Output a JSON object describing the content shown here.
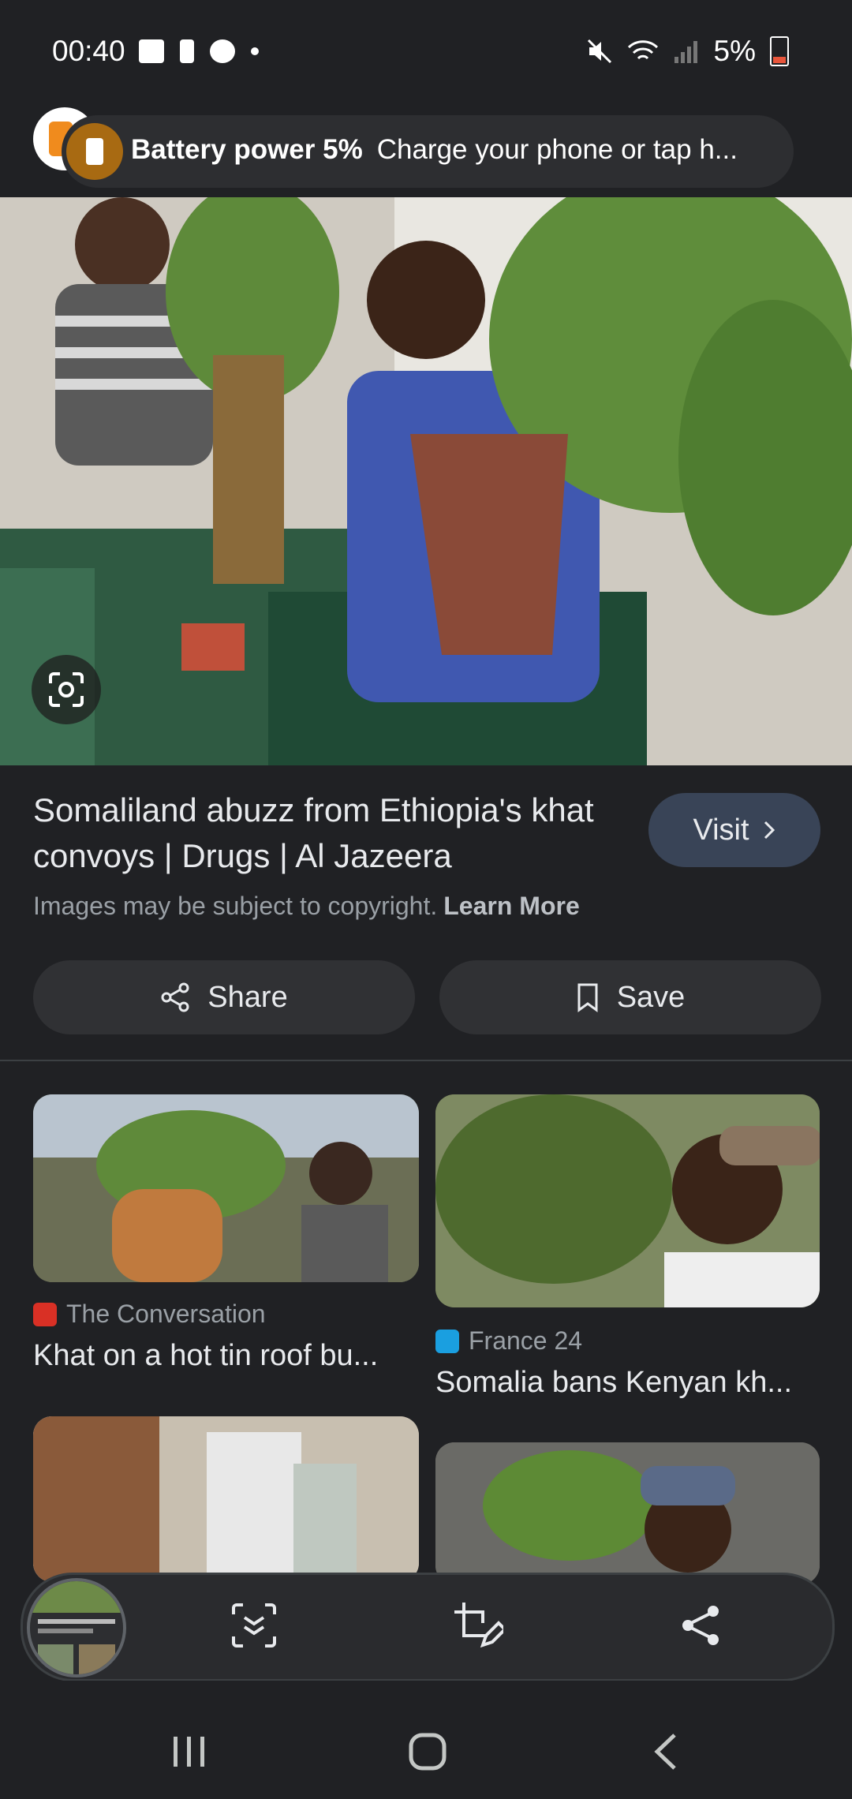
{
  "status_bar": {
    "time": "00:40",
    "battery_percent": "5%"
  },
  "notification": {
    "title": "Battery power 5%",
    "body": "Charge your phone or tap h..."
  },
  "result": {
    "title": "Somaliland abuzz from Ethiopia's khat convoys | Drugs | Al Jazeera",
    "visit_label": "Visit",
    "copyright_text": "Images may be subject to copyright.",
    "learn_more": "Learn More",
    "share_label": "Share",
    "save_label": "Save"
  },
  "related": [
    {
      "source": "The Conversation",
      "title": "Khat on a hot tin roof bu...",
      "favicon_color": "#d93025"
    },
    {
      "source": "France 24",
      "title": "Somalia bans Kenyan kh...",
      "favicon_color": "#1a9fe0"
    }
  ],
  "colors": {
    "background": "#202124",
    "visit_button": "#394457",
    "pill_button": "#303134",
    "battery_icon": "#a86a12"
  },
  "icons": {
    "lens": "google-lens-icon",
    "toolbar": [
      "smart-select-icon",
      "crop-edit-icon",
      "share-icon"
    ],
    "nav": [
      "recents-icon",
      "home-icon",
      "back-icon"
    ]
  }
}
